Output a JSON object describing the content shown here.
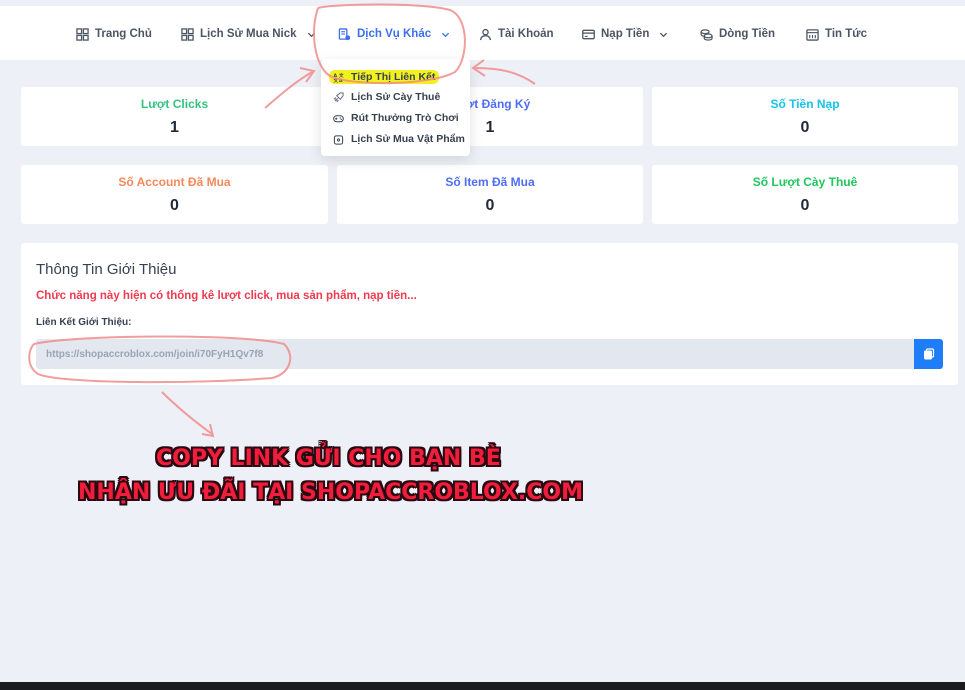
{
  "nav": {
    "items": [
      {
        "label": "Trang Chủ",
        "icon": "grid-icon"
      },
      {
        "label": "Lịch Sử Mua Nick",
        "icon": "grid-icon",
        "has_dropdown": true
      },
      {
        "label": "Dịch Vụ Khác",
        "icon": "services-icon",
        "has_dropdown": true,
        "active": true
      },
      {
        "label": "Tài Khoản",
        "icon": "user-icon"
      },
      {
        "label": "Nạp Tiền",
        "icon": "card-icon",
        "has_dropdown": true
      },
      {
        "label": "Dòng Tiền",
        "icon": "coins-icon"
      },
      {
        "label": "Tin Tức",
        "icon": "calendar-icon"
      }
    ]
  },
  "dropdown": {
    "items": [
      {
        "label": "Tiếp Thị Liên Kết",
        "icon": "translate-icon",
        "highlighted": true
      },
      {
        "label": "Lịch Sử Cày Thuê",
        "icon": "rocket-icon"
      },
      {
        "label": "Rút Thưởng Trò Chơi",
        "icon": "gamepad-icon"
      },
      {
        "label": "Lịch Sử Mua Vật Phẩm",
        "icon": "box-icon"
      }
    ]
  },
  "stats": [
    {
      "label": "Lượt Clicks",
      "value": "1",
      "color": "#34c37f"
    },
    {
      "label": "Lượt Đăng Ký",
      "value": "1",
      "color": "#4f6df5"
    },
    {
      "label": "Số Tiền Nạp",
      "value": "0",
      "color": "#16c4e8"
    },
    {
      "label": "Số Account Đã Mua",
      "value": "0",
      "color": "#f5885a"
    },
    {
      "label": "Số Item Đã Mua",
      "value": "0",
      "color": "#4f6df5"
    },
    {
      "label": "Số Lượt Cày Thuê",
      "value": "0",
      "color": "#22c55e"
    }
  ],
  "referral": {
    "title": "Thông Tin Giới Thiệu",
    "description": "Chức năng này hiện có thống kê lượt click, mua sản phẩm, nạp tiền...",
    "link_label": "Liên Kết Giới Thiệu:",
    "link_value": "https://shopaccroblox.com/join/i70FyH1Qv7f8",
    "copy_icon": "copy-icon"
  },
  "annotation": {
    "line1": "COPY LINK GỬI CHO BẠN BÈ",
    "line2": "NHẬN ƯU ĐÃI TẠI SHOPACCROBLOX.COM",
    "color": "#f21d3a"
  },
  "colors": {
    "accent": "#3b6ff0",
    "button": "#1f7ef7",
    "highlight": "#f2f01e"
  }
}
